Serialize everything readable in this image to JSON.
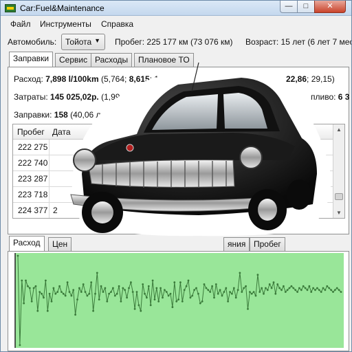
{
  "window": {
    "title": "Car:Fuel&Maintenance",
    "min_glyph": "—",
    "max_glyph": "□",
    "close_glyph": "✕"
  },
  "menu": [
    "Файл",
    "Инструменты",
    "Справка"
  ],
  "car_bar": {
    "car_label": "Автомобиль:",
    "car_value": "Тойота",
    "mileage": "Пробег: 225 177 км (73 076 км)",
    "age": "Возраст: 15 лет (6 лет 7 мес."
  },
  "top_tabs": [
    "Заправки",
    "Сервис",
    "Расходы",
    "Плановое ТО"
  ],
  "stats": {
    "consumption": {
      "label": "Расход:",
      "value": "7,898 l/100km",
      "detail": "(5,764;",
      "value2": "8,615",
      "detail2": "; 1",
      "right_value": "22,86",
      "right_detail": "; 29,15)"
    },
    "costs": {
      "label": "Затраты:",
      "value": "145 025,02р.",
      "detail": "(1,99р./км",
      "right_label": "пливо:",
      "right_value": "6 3"
    },
    "refuels": {
      "label": "Заправки:",
      "value": "158",
      "detail": "(40,06 л/запр.; 1"
    }
  },
  "grid": {
    "columns": [
      "Пробег",
      "Дата"
    ],
    "rows": [
      {
        "mileage": "222 275",
        "date": ""
      },
      {
        "mileage": "222 740",
        "date": ""
      },
      {
        "mileage": "223 287",
        "date": ""
      },
      {
        "mileage": "223 718",
        "date": ""
      },
      {
        "mileage": "224 377",
        "date": "2"
      }
    ]
  },
  "bottom_tabs": [
    "Расход",
    "Цен",
    "яния",
    "Пробег"
  ],
  "colors": {
    "chart_fill": "#99e699",
    "chart_line": "#3a7a3a",
    "chart_axis": "#222222"
  },
  "chart_data": {
    "type": "line",
    "series": [
      {
        "values": [
          118,
          24,
          92,
          68,
          92,
          86,
          84,
          70,
          84,
          86,
          60,
          80,
          78,
          74,
          92,
          60,
          78,
          70,
          84,
          78,
          80,
          86,
          80,
          78,
          76,
          90,
          80,
          76,
          82,
          56,
          72,
          84,
          80,
          88,
          80,
          76,
          78,
          90,
          60,
          78,
          100,
          72,
          86,
          80,
          84,
          70,
          78,
          80,
          84,
          76,
          78,
          86,
          70,
          84,
          82,
          74,
          84,
          90,
          80,
          62,
          80,
          66,
          60,
          88,
          78,
          74,
          86,
          66,
          92,
          72,
          84,
          70,
          84,
          74,
          82,
          80,
          76,
          78,
          64,
          90,
          70,
          72,
          90,
          70,
          82,
          86,
          92,
          74,
          76,
          82,
          84,
          78,
          68,
          70,
          88,
          84,
          82,
          80,
          86,
          74,
          88,
          78,
          82,
          76,
          80,
          84,
          70,
          80,
          78,
          84,
          74,
          82,
          100,
          80,
          84,
          86,
          62,
          80,
          78,
          80,
          76,
          98,
          80,
          84,
          78,
          84,
          82,
          88,
          84,
          90,
          78,
          88,
          84,
          82,
          86,
          80,
          82,
          84,
          86,
          84,
          82,
          80,
          84,
          82,
          86,
          84,
          82,
          86,
          80,
          84,
          82,
          84,
          82,
          80,
          84,
          82,
          86,
          84,
          82,
          80,
          82,
          84,
          82,
          80
        ]
      }
    ],
    "grid": false
  },
  "car_image_name": "volga-car-photo"
}
